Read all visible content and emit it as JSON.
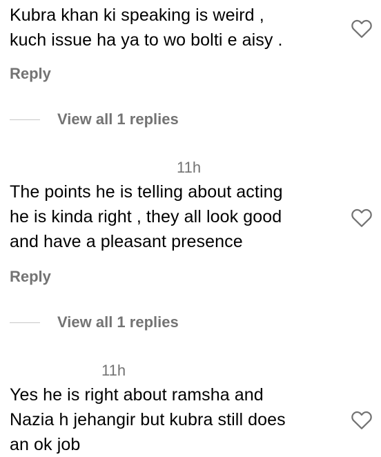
{
  "comments": [
    {
      "lines": [
        "Kubra khan ki speaking is weird ,",
        "kuch issue ha ya to wo bolti e aisy ."
      ],
      "reply_label": "Reply",
      "view_replies_label": "View all 1 replies"
    },
    {
      "time": "11h",
      "lines": [
        "The points he is telling about acting",
        "he is kinda right , they all look good",
        "and have a pleasant presence"
      ],
      "reply_label": "Reply",
      "view_replies_label": "View all 1 replies"
    },
    {
      "time": "11h",
      "lines": [
        "Yes he is right about ramsha and",
        "Nazia h jehangir but kubra still does",
        "an ok job"
      ]
    }
  ],
  "icons": {
    "like": "heart-outline-icon"
  },
  "colors": {
    "text": "#000000",
    "secondary": "#737373",
    "divider": "#c7c7c7",
    "background": "#ffffff"
  }
}
